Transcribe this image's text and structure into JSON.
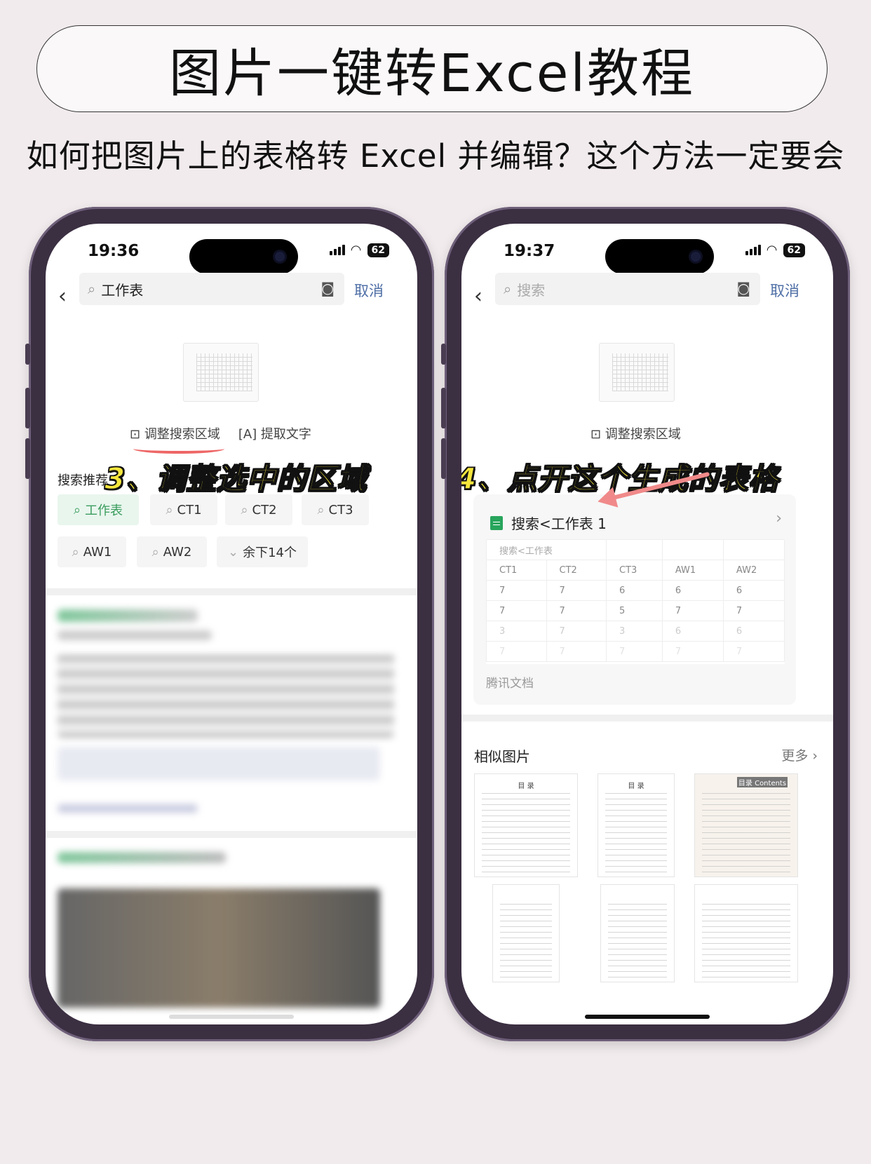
{
  "header": {
    "title": "图片一键转Excel教程",
    "subtitle": "如何把图片上的表格转 Excel 并编辑？这个方法一定要会"
  },
  "phone_left": {
    "time": "19:36",
    "battery": "62",
    "search_text": "工作表",
    "cancel_label": "取消",
    "adjust_label": "调整搜索区域",
    "extract_label": "提取文字",
    "annotation": "3、调整选中的区域",
    "recommend_label": "搜索推荐",
    "chips": [
      "工作表",
      "CT1",
      "CT2",
      "CT3",
      "AW1",
      "AW2",
      "余下14个"
    ]
  },
  "phone_right": {
    "time": "19:37",
    "battery": "62",
    "search_placeholder": "搜索",
    "cancel_label": "取消",
    "adjust_label": "调整搜索区域",
    "annotation": "4、点开这个生成的表格",
    "result_title": "搜索<工作表 1",
    "table": {
      "header_cell": "搜索<工作表",
      "columns": [
        "CT1",
        "CT2",
        "CT3",
        "AW1",
        "AW2"
      ],
      "rows": [
        [
          "7",
          "7",
          "6",
          "6",
          "6"
        ],
        [
          "7",
          "7",
          "5",
          "7",
          "7"
        ],
        [
          "3",
          "7",
          "3",
          "6",
          "6"
        ],
        [
          "7",
          "7",
          "7",
          "7",
          "7"
        ]
      ]
    },
    "result_source": "腾讯文档",
    "similar_label": "相似图片",
    "more_label": "更多",
    "similar_docs": [
      "目 录",
      "目 录",
      "目录 Contents",
      "",
      "",
      ""
    ]
  }
}
